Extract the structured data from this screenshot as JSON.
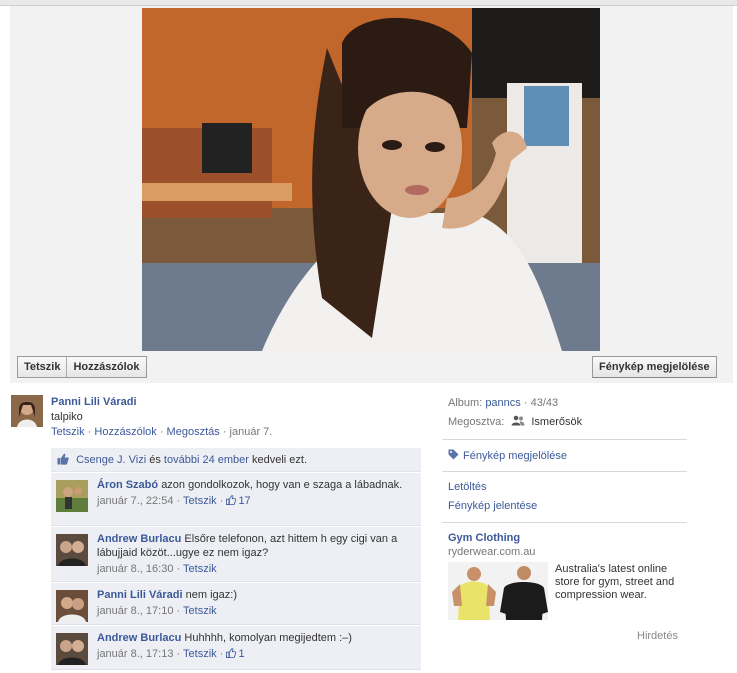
{
  "photo_actions": {
    "like": "Tetszik",
    "comment": "Hozzászólok",
    "tag": "Fénykép megjelölése"
  },
  "post": {
    "author": "Panni Lili Váradi",
    "caption": "talpiko",
    "actions": {
      "like": "Tetszik",
      "comment": "Hozzászólok",
      "share": "Megosztás",
      "date": "január 7."
    }
  },
  "likes": {
    "name": "Csenge J. Vizi",
    "and": "és",
    "others": "további 24 ember",
    "suffix": "kedveli ezt."
  },
  "comments": [
    {
      "author": "Áron Szabó",
      "text": "azon gondolkozok, hogy van e szaga a lábadnak.",
      "time": "január 7., 22:54",
      "like": "Tetszik",
      "likes": "17"
    },
    {
      "author": "Andrew Burlacu",
      "text": "Elsőre telefonon, azt hittem h egy cigi van a lábujjaid közöt...ugye ez nem igaz?",
      "time": "január 8., 16:30",
      "like": "Tetszik"
    },
    {
      "author": "Panni Lili Váradi",
      "text": "nem igaz:)",
      "time": "január 8., 17:10",
      "like": "Tetszik"
    },
    {
      "author": "Andrew Burlacu",
      "text": "Huhhhh, komolyan megijedtem :–)",
      "time": "január 8., 17:13",
      "like": "Tetszik",
      "likes": "1"
    }
  ],
  "sidebar": {
    "album_label": "Album:",
    "album_name": "panncs",
    "album_count": "· 43/43",
    "shared_label": "Megosztva:",
    "shared_value": "Ismerősök",
    "tag_photo": "Fénykép megjelölése",
    "download": "Letöltés",
    "report": "Fénykép jelentése"
  },
  "ad": {
    "title": "Gym Clothing",
    "url": "ryderwear.com.au",
    "text": "Australia's latest online store for gym, street and compression wear.",
    "label": "Hirdetés"
  },
  "colors": {
    "link": "#3b5998",
    "comment_bg": "#edeff4",
    "stage_bg": "#f2f2f2"
  }
}
